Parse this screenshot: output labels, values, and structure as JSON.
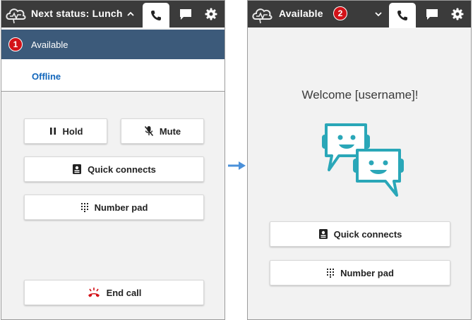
{
  "left_panel": {
    "status_label": "Next status: Lunch",
    "step_badge": "1",
    "dropdown": {
      "items": [
        {
          "label": "Available",
          "selected": true
        },
        {
          "label": "Offline",
          "selected": false
        }
      ]
    },
    "buttons": {
      "hold": "Hold",
      "mute": "Mute",
      "quick_connects": "Quick connects",
      "number_pad": "Number pad",
      "end_call": "End call"
    }
  },
  "right_panel": {
    "status_label": "Available",
    "step_badge": "2",
    "welcome_text": "Welcome [username]!",
    "buttons": {
      "quick_connects": "Quick connects",
      "number_pad": "Number pad"
    }
  },
  "colors": {
    "topbar": "#3b3b3b",
    "selected_item": "#3c5a7a",
    "offline_text": "#1166bb",
    "badge": "#d31218",
    "bot_teal": "#2aa7b8",
    "end_call_red": "#d31218",
    "arrow": "#4a90d9"
  },
  "icons": [
    "cloud-logo-icon",
    "chevron-up-icon",
    "chevron-down-icon",
    "phone-icon",
    "chat-icon",
    "gear-icon",
    "pause-icon",
    "mic-off-icon",
    "contact-card-icon",
    "dial-pad-icon",
    "end-call-icon",
    "chat-bots-illustration",
    "right-arrow-icon"
  ]
}
